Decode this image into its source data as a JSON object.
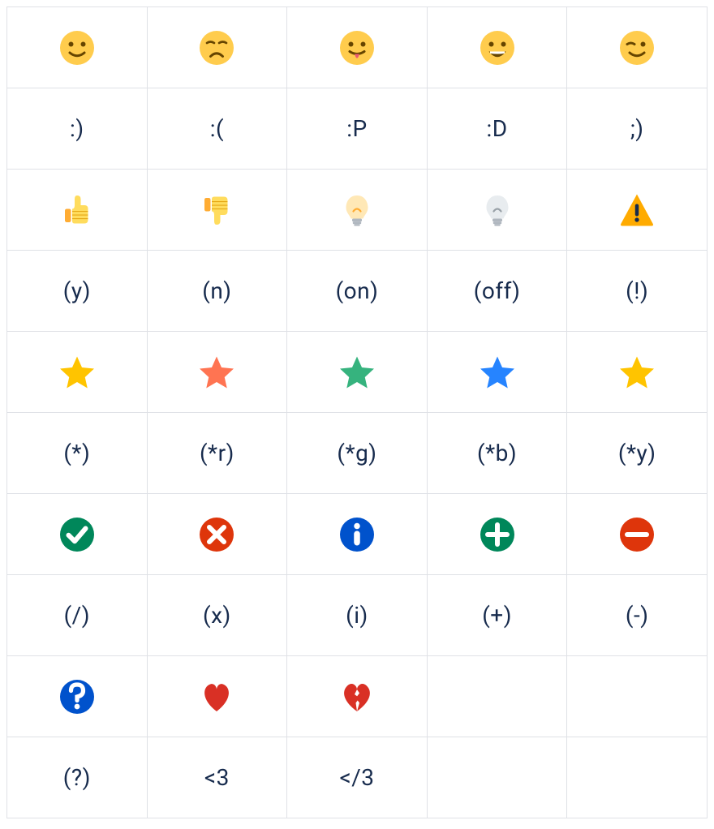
{
  "table": {
    "columns": 5,
    "groups": [
      {
        "icons": [
          {
            "name": "smile-icon",
            "type": "face",
            "variant": "smile"
          },
          {
            "name": "sad-icon",
            "type": "face",
            "variant": "sad"
          },
          {
            "name": "tongue-icon",
            "type": "face",
            "variant": "tongue"
          },
          {
            "name": "grin-icon",
            "type": "face",
            "variant": "grin"
          },
          {
            "name": "wink-icon",
            "type": "face",
            "variant": "wink"
          }
        ],
        "shortcuts": [
          ":)",
          ":(",
          ":P",
          ":D",
          ";)"
        ]
      },
      {
        "icons": [
          {
            "name": "thumbs-up-icon",
            "type": "thumb",
            "variant": "up"
          },
          {
            "name": "thumbs-down-icon",
            "type": "thumb",
            "variant": "down"
          },
          {
            "name": "lightbulb-on-icon",
            "type": "bulb",
            "variant": "on"
          },
          {
            "name": "lightbulb-off-icon",
            "type": "bulb",
            "variant": "off"
          },
          {
            "name": "warning-icon",
            "type": "warning"
          }
        ],
        "shortcuts": [
          "(y)",
          "(n)",
          "(on)",
          "(off)",
          "(!)"
        ]
      },
      {
        "icons": [
          {
            "name": "star-yellow-icon",
            "type": "star",
            "color": "#ffc400"
          },
          {
            "name": "star-red-icon",
            "type": "star",
            "color": "#ff7452"
          },
          {
            "name": "star-green-icon",
            "type": "star",
            "color": "#36b37e"
          },
          {
            "name": "star-blue-icon",
            "type": "star",
            "color": "#2684ff"
          },
          {
            "name": "star-yellow2-icon",
            "type": "star",
            "color": "#ffc400"
          }
        ],
        "shortcuts": [
          "(*)",
          "(*r)",
          "(*g)",
          "(*b)",
          "(*y)"
        ]
      },
      {
        "icons": [
          {
            "name": "check-icon",
            "type": "circle",
            "bg": "#00875a",
            "glyph": "check"
          },
          {
            "name": "cross-icon",
            "type": "circle",
            "bg": "#de350b",
            "glyph": "cross"
          },
          {
            "name": "info-icon",
            "type": "circle",
            "bg": "#0052cc",
            "glyph": "info"
          },
          {
            "name": "plus-icon",
            "type": "circle",
            "bg": "#00875a",
            "glyph": "plus"
          },
          {
            "name": "minus-icon",
            "type": "circle",
            "bg": "#de350b",
            "glyph": "minus"
          }
        ],
        "shortcuts": [
          "(/)",
          "(x)",
          "(i)",
          "(+)",
          "(-)"
        ]
      },
      {
        "icons": [
          {
            "name": "question-icon",
            "type": "circle",
            "bg": "#0052cc",
            "glyph": "question"
          },
          {
            "name": "heart-icon",
            "type": "heart",
            "variant": "full"
          },
          {
            "name": "broken-heart-icon",
            "type": "heart",
            "variant": "broken"
          },
          {
            "name": "",
            "type": "empty"
          },
          {
            "name": "",
            "type": "empty"
          }
        ],
        "shortcuts": [
          "(?)",
          "<3",
          "</3",
          "",
          ""
        ]
      }
    ]
  }
}
